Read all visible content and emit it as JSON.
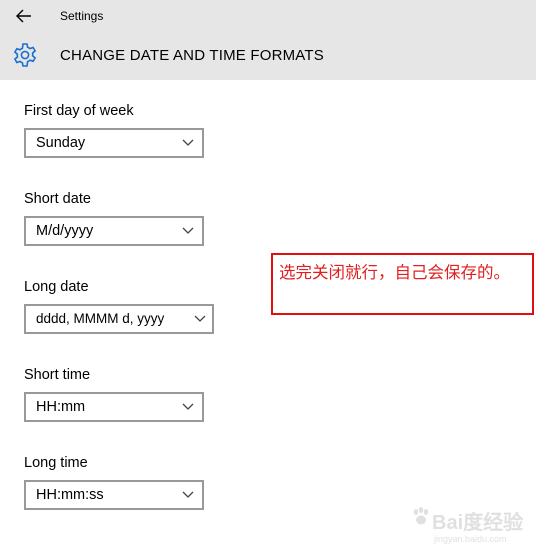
{
  "window": {
    "app_title": "Settings",
    "back_icon": "back-arrow-icon"
  },
  "header": {
    "icon": "gear-icon",
    "page_title": "CHANGE DATE AND TIME FORMATS"
  },
  "settings": {
    "first_day_of_week": {
      "label": "First day of week",
      "value": "Sunday"
    },
    "short_date": {
      "label": "Short date",
      "value": "M/d/yyyy"
    },
    "long_date": {
      "label": "Long date",
      "value": "dddd, MMMM d, yyyy"
    },
    "short_time": {
      "label": "Short time",
      "value": "HH:mm"
    },
    "long_time": {
      "label": "Long time",
      "value": "HH:mm:ss"
    }
  },
  "annotation": {
    "text": "选完关闭就行，自己会保存的。",
    "color": "#e02020"
  },
  "watermark": {
    "text": "Bai度经验",
    "subtext": "jingyan.baidu.com"
  },
  "colors": {
    "header_bg": "#e6e6e6",
    "accent": "#1a6fd1",
    "select_border": "#999999"
  }
}
